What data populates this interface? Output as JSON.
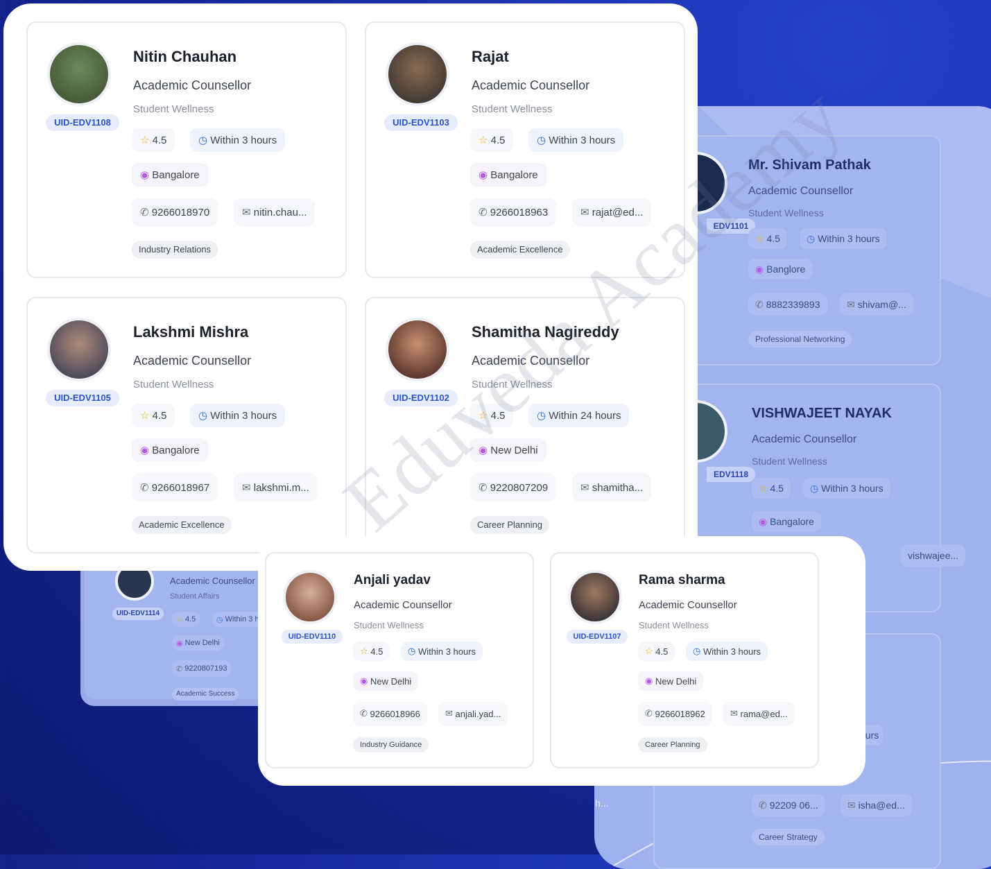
{
  "watermark": "Eduveda Academy",
  "cards": {
    "nitin": {
      "name": "Nitin Chauhan",
      "role": "Academic Counsellor",
      "dept": "Student Wellness",
      "uid": "UID-EDV1108",
      "rating": "4.5",
      "response": "Within 3 hours",
      "location": "Bangalore",
      "phone": "9266018970",
      "email": "nitin.chau...",
      "tag": "Industry Relations"
    },
    "rajat": {
      "name": "Rajat",
      "role": "Academic Counsellor",
      "dept": "Student Wellness",
      "uid": "UID-EDV1103",
      "rating": "4.5",
      "response": "Within 3 hours",
      "location": "Bangalore",
      "phone": "9266018963",
      "email": "rajat@ed...",
      "tag": "Academic Excellence"
    },
    "lakshmi": {
      "name": "Lakshmi Mishra",
      "role": "Academic Counsellor",
      "dept": "Student Wellness",
      "uid": "UID-EDV1105",
      "rating": "4.5",
      "response": "Within 3 hours",
      "location": "Bangalore",
      "phone": "9266018967",
      "email": "lakshmi.m...",
      "tag": "Academic Excellence"
    },
    "shamitha": {
      "name": "Shamitha Nagireddy",
      "role": "Academic Counsellor",
      "dept": "Student Wellness",
      "uid": "UID-EDV1102",
      "rating": "4.5",
      "response": "Within 24 hours",
      "location": "New Delhi",
      "phone": "9220807209",
      "email": "shamitha...",
      "tag": "Career Planning"
    },
    "anjali": {
      "name": "Anjali yadav",
      "role": "Academic Counsellor",
      "dept": "Student Wellness",
      "uid": "UID-EDV1110",
      "rating": "4.5",
      "response": "Within 3 hours",
      "location": "New Delhi",
      "phone": "9266018966",
      "email": "anjali.yad...",
      "tag": "Industry Guidance"
    },
    "rama": {
      "name": "Rama sharma",
      "role": "Academic Counsellor",
      "dept": "Student Wellness",
      "uid": "UID-EDV1107",
      "rating": "4.5",
      "response": "Within 3 hours",
      "location": "New Delhi",
      "phone": "9266018962",
      "email": "rama@ed...",
      "tag": "Career Planning"
    },
    "shivam": {
      "name": "Mr. Shivam Pathak",
      "role": "Academic Counsellor",
      "dept": "Student Wellness",
      "uid": "EDV1101",
      "rating": "4.5",
      "response": "Within 3 hours",
      "location": "Banglore",
      "phone": "8882339893",
      "email": "shivam@...",
      "tag": "Professional Networking"
    },
    "vishwajeet": {
      "name": "VISHWAJEET NAYAK",
      "role": "Academic Counsellor",
      "dept": "Student Wellness",
      "uid": "EDV1118",
      "rating": "4.5",
      "response": "Within 3 hours",
      "location": "Bangalore",
      "email": "vishwajee..."
    },
    "leftBehind": {
      "role": "Academic Counsellor",
      "dept": "Student Affairs",
      "uid": "UID-EDV1114",
      "rating": "4.5",
      "response": "Within 3 h",
      "location": "New Delhi",
      "phone": "9220807193",
      "tag": "Academic Success"
    },
    "rightBottom": {
      "response": "ours",
      "phone": "92209 06...",
      "email": "isha@ed...",
      "tag": "Career Strategy",
      "fragment": "h..."
    }
  },
  "colors": {
    "accent": "#2a54c7",
    "star": "#e9b400",
    "clock": "#2f6fe0",
    "pin": "#b25be0",
    "background": "#142593"
  },
  "icons": [
    "star-icon",
    "clock-icon",
    "location-pin-icon",
    "phone-icon",
    "mail-icon"
  ]
}
